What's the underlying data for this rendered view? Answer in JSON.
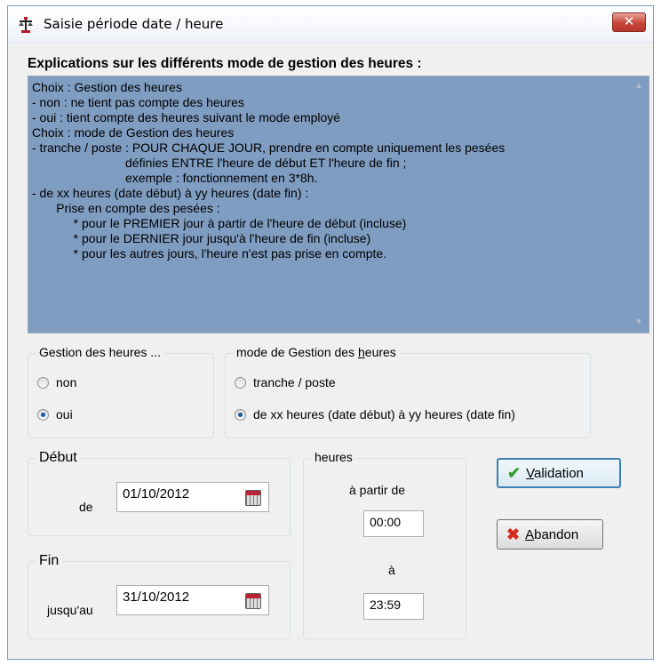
{
  "window": {
    "title": "Saisie période date / heure",
    "close_label": "✕"
  },
  "explanations": {
    "heading": "Explications sur les différents mode de gestion des heures :",
    "lines": [
      "Choix : Gestion des heures",
      "- non : ne tient pas compte des heures",
      "- oui : tient compte des heures suivant le mode employé",
      "Choix : mode de Gestion des heures",
      "- tranche / poste : POUR CHAQUE JOUR, prendre en compte uniquement les pesées",
      "                           définies ENTRE l'heure de début ET l'heure de fin ;",
      "                           exemple : fonctionnement en 3*8h.",
      "- de xx heures (date début) à yy heures (date fin) :",
      "       Prise en compte des pesées :",
      "            * pour le PREMIER jour à partir de l'heure de début (incluse)",
      "            * pour le DERNIER jour jusqu'à l'heure de fin (incluse)",
      "            * pour les autres jours, l'heure n'est pas prise en compte."
    ]
  },
  "gestion": {
    "legend": "Gestion des heures ...",
    "options": [
      {
        "label": "non",
        "checked": false
      },
      {
        "label": "oui",
        "checked": true
      }
    ]
  },
  "mode": {
    "legend_pre": "mode de Gestion des ",
    "legend_accel": "h",
    "legend_post": "eures",
    "options": [
      {
        "label": "tranche / poste",
        "checked": false
      },
      {
        "label": "de xx heures (date début) à yy heures (date fin)",
        "checked": true
      }
    ]
  },
  "debut": {
    "legend": "Début",
    "label": "de",
    "date": "01/10/2012"
  },
  "fin": {
    "legend": "Fin",
    "label": "jusqu'au",
    "date": "31/10/2012"
  },
  "heures": {
    "legend": "heures",
    "from_label": "à partir de",
    "from_value": "00:00",
    "to_label": "à",
    "to_value": "23:59"
  },
  "buttons": {
    "validation_accel": "V",
    "validation_rest": "alidation",
    "abandon_accel": "A",
    "abandon_rest": "bandon"
  },
  "icons": {
    "app": "balance-icon",
    "calendar": "calendar-icon",
    "check": "check-icon",
    "cross": "cross-icon"
  }
}
